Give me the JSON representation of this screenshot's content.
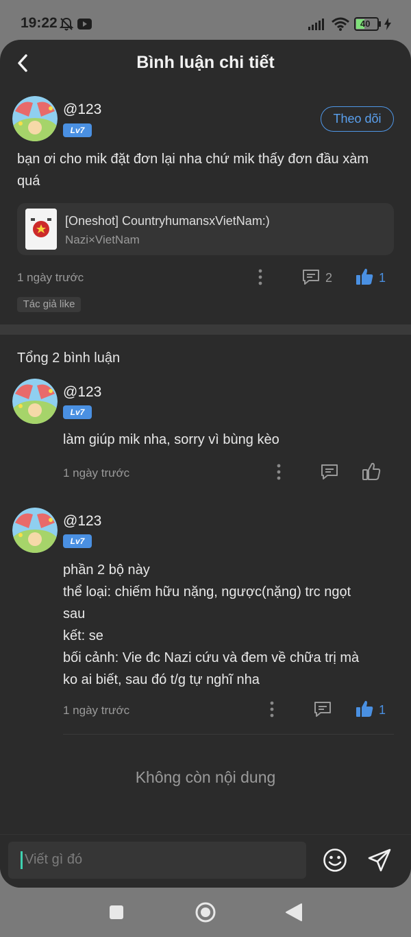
{
  "status_bar": {
    "time": "19:22",
    "battery": "40"
  },
  "header": {
    "title": "Bình luận chi tiết"
  },
  "main_comment": {
    "username": "@123",
    "level": "Lv7",
    "follow_label": "Theo dõi",
    "text_line1": "bạn ơi cho mik đặt đơn lại nha chứ mik thấy đơn đầu xàm",
    "text_line2": "quá",
    "story_title": "[Oneshot] CountryhumansxVietNam:)",
    "story_subtitle": "Nazi×VietNam",
    "time": "1 ngày trước",
    "reply_count": "2",
    "like_count": "1",
    "tag": "Tác giả like"
  },
  "replies_header": "Tổng 2 bình luận",
  "replies": [
    {
      "username": "@123",
      "level": "Lv7",
      "text": "làm giúp mik nha, sorry vì bùng kèo",
      "time": "1 ngày trước"
    },
    {
      "username": "@123",
      "level": "Lv7",
      "lines": [
        "phần 2 bộ này",
        "thể loại: chiếm hữu nặng, ngược(nặng) trc ngọt",
        "sau",
        "kết: se",
        "bối cảnh: Vie đc Nazi cứu và đem về chữa trị mà",
        "ko ai biết, sau đó t/g tự nghĩ nha"
      ],
      "time": "1 ngày trước",
      "like_count": "1"
    }
  ],
  "end_text": "Không còn nội dung",
  "input": {
    "placeholder": "Viết gì đó"
  },
  "icons": {
    "status": [
      "bell-off-icon",
      "youtube-icon",
      "signal-icon",
      "wifi-icon",
      "battery-icon",
      "charging-icon"
    ],
    "actions": [
      "more-vertical-icon",
      "comment-icon",
      "thumbs-up-icon",
      "emoji-icon",
      "send-icon"
    ],
    "nav": [
      "recents-icon",
      "home-icon",
      "back-icon"
    ]
  },
  "colors": {
    "background": "#2b2b2b",
    "accent": "#4a90e2",
    "muted_text": "#9a9a9a",
    "caret": "#3fd1b0"
  }
}
